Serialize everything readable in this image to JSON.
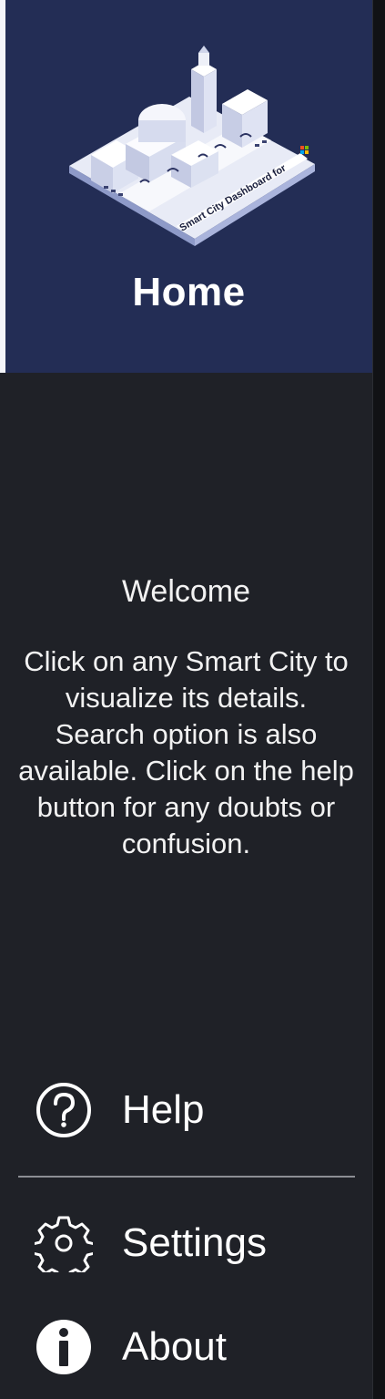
{
  "header": {
    "title": "Home",
    "illustration_sign_text": "Smart City Dashboard for",
    "background_color": "#232d55"
  },
  "content": {
    "welcome": "Welcome",
    "intro": "Click on any Smart City to visualize its details. Search option is also available. Click on the help button for any doubts or confusion."
  },
  "menu": [
    {
      "label": "Help",
      "icon": "help-circle-icon"
    },
    {
      "label": "Settings",
      "icon": "gear-icon"
    },
    {
      "label": "About",
      "icon": "info-icon"
    }
  ],
  "colors": {
    "drawer_background": "#1f2127",
    "text": "#ffffff",
    "divider": "#8c8e94"
  }
}
